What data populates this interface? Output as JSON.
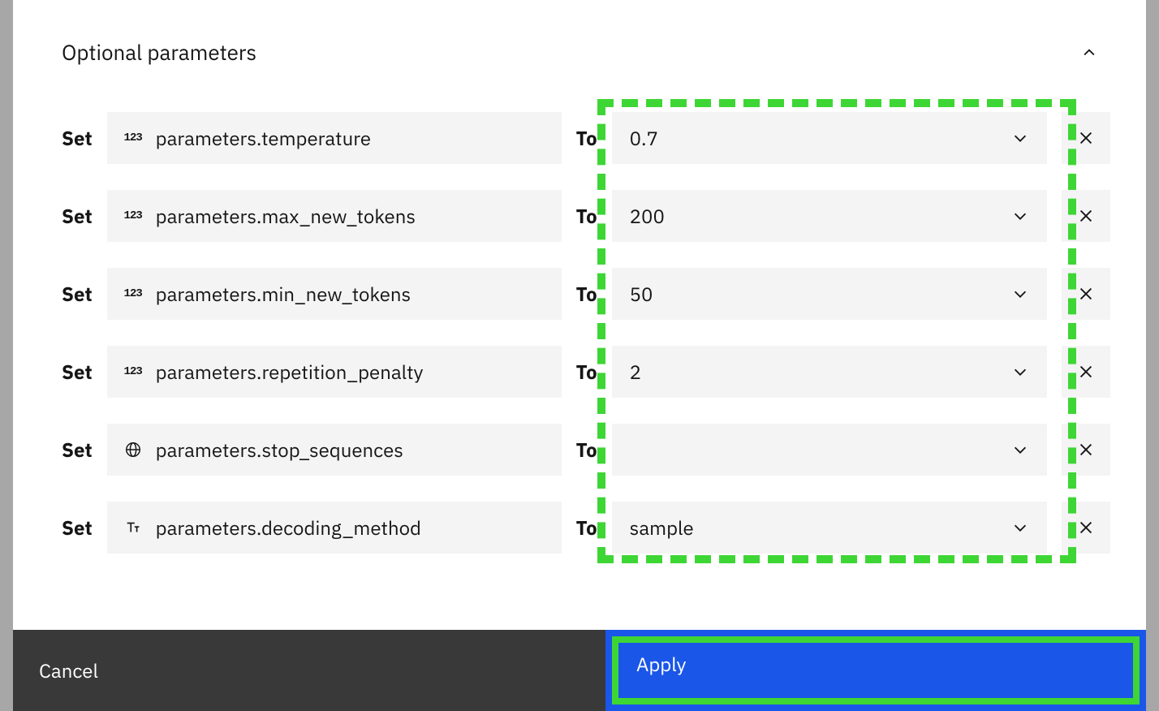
{
  "section": {
    "title": "Optional parameters"
  },
  "labels": {
    "set": "Set",
    "to": "To"
  },
  "rows": [
    {
      "type": "number",
      "param": "parameters.temperature",
      "value": "0.7"
    },
    {
      "type": "number",
      "param": "parameters.max_new_tokens",
      "value": "200"
    },
    {
      "type": "number",
      "param": "parameters.min_new_tokens",
      "value": "50"
    },
    {
      "type": "number",
      "param": "parameters.repetition_penalty",
      "value": "2"
    },
    {
      "type": "globe",
      "param": "parameters.stop_sequences",
      "value": ""
    },
    {
      "type": "text",
      "param": "parameters.decoding_method",
      "value": "sample"
    }
  ],
  "footer": {
    "cancel": "Cancel",
    "apply": "Apply"
  },
  "highlight": {
    "color": "#3ED635"
  }
}
